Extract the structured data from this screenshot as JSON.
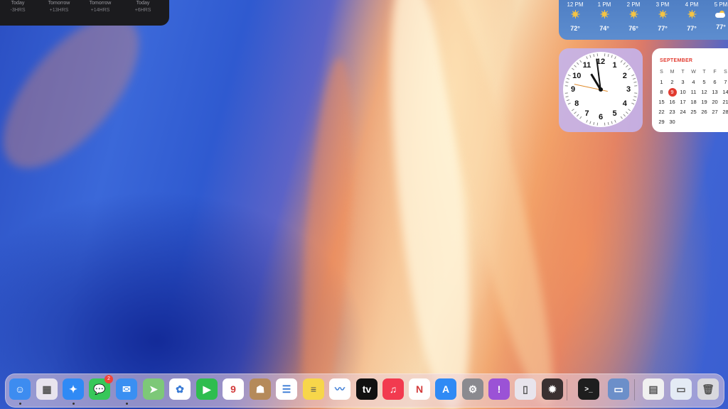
{
  "world_clock": {
    "cities": [
      {
        "day": "Today",
        "offset": "-3HRS"
      },
      {
        "day": "Tomorrow",
        "offset": "+13HRS"
      },
      {
        "day": "Tomorrow",
        "offset": "+14HRS"
      },
      {
        "day": "Today",
        "offset": "+6HRS"
      }
    ]
  },
  "weather": {
    "hours": [
      {
        "time": "12 PM",
        "icon": "sun-icon",
        "temp": "72°"
      },
      {
        "time": "1 PM",
        "icon": "sun-icon",
        "temp": "74°"
      },
      {
        "time": "2 PM",
        "icon": "sun-icon",
        "temp": "76°"
      },
      {
        "time": "3 PM",
        "icon": "sun-icon",
        "temp": "77°"
      },
      {
        "time": "4 PM",
        "icon": "sun-icon",
        "temp": "77°"
      },
      {
        "time": "5 PM",
        "icon": "partly-cloudy-icon",
        "temp": "77°"
      }
    ]
  },
  "clock": {
    "numerals": [
      "12",
      "1",
      "2",
      "3",
      "4",
      "5",
      "6",
      "7",
      "8",
      "9",
      "10",
      "11"
    ],
    "time": {
      "hour": 10,
      "minute": 58,
      "second": 47
    }
  },
  "calendar": {
    "month": "SEPTEMBER",
    "weekdays": [
      "S",
      "M",
      "T",
      "W",
      "T",
      "F",
      "S"
    ],
    "weeks": [
      [
        "1",
        "2",
        "3",
        "4",
        "5",
        "6",
        "7"
      ],
      [
        "8",
        "9",
        "10",
        "11",
        "12",
        "13",
        "14"
      ],
      [
        "15",
        "16",
        "17",
        "18",
        "19",
        "20",
        "21"
      ],
      [
        "22",
        "23",
        "24",
        "25",
        "26",
        "27",
        "28"
      ],
      [
        "29",
        "30",
        "",
        "",
        "",
        "",
        ""
      ]
    ],
    "today": "9"
  },
  "dock": {
    "apps": [
      {
        "name": "finder-icon",
        "color": "#3d8cf0",
        "glyph": "☺",
        "running": true
      },
      {
        "name": "launchpad-icon",
        "color": "#e8e4ee",
        "glyph": "▦",
        "running": false
      },
      {
        "name": "safari-icon",
        "color": "#2f8af5",
        "glyph": "✦",
        "running": true
      },
      {
        "name": "messages-icon",
        "color": "#37c759",
        "glyph": "💬",
        "running": false,
        "badge": "2"
      },
      {
        "name": "mail-icon",
        "color": "#3a8ff2",
        "glyph": "✉",
        "running": true
      },
      {
        "name": "maps-icon",
        "color": "#7dc878",
        "glyph": "➤",
        "running": false
      },
      {
        "name": "photos-icon",
        "color": "#ffffff",
        "glyph": "✿",
        "running": false
      },
      {
        "name": "facetime-icon",
        "color": "#2ebd4f",
        "glyph": "▶",
        "running": false
      },
      {
        "name": "calendar-icon",
        "color": "#ffffff",
        "glyph": "9",
        "running": false
      },
      {
        "name": "contacts-icon",
        "color": "#b58a5a",
        "glyph": "☗",
        "running": false
      },
      {
        "name": "reminders-icon",
        "color": "#ffffff",
        "glyph": "☰",
        "running": false
      },
      {
        "name": "notes-icon",
        "color": "#f7d64a",
        "glyph": "≡",
        "running": false
      },
      {
        "name": "freeform-icon",
        "color": "#ffffff",
        "glyph": "〰",
        "running": false
      },
      {
        "name": "appletv-icon",
        "color": "#111111",
        "glyph": "tv",
        "running": false
      },
      {
        "name": "music-icon",
        "color": "#f23a4f",
        "glyph": "♫",
        "running": false
      },
      {
        "name": "news-icon",
        "color": "#ffffff",
        "glyph": "N",
        "running": false
      },
      {
        "name": "appstore-icon",
        "color": "#2f8af5",
        "glyph": "A",
        "running": false
      },
      {
        "name": "system-settings-icon",
        "color": "#8a8a8f",
        "glyph": "⚙",
        "running": false
      },
      {
        "name": "feedback-icon",
        "color": "#9b52d6",
        "glyph": "!",
        "running": false
      },
      {
        "name": "iphone-mirroring-icon",
        "color": "#e8e4ec",
        "glyph": "▯",
        "running": false
      },
      {
        "name": "bug-app-icon",
        "color": "#3a3030",
        "glyph": "✹",
        "running": false
      },
      {
        "name": "terminal-icon",
        "color": "#1e1e1e",
        "glyph": ">_",
        "running": false
      },
      {
        "name": "preview-icon",
        "color": "#6c8fc9",
        "glyph": "▭",
        "running": false
      },
      {
        "name": "document-icon",
        "color": "#f0f0f0",
        "glyph": "▤",
        "running": false
      },
      {
        "name": "window-stack-icon",
        "color": "#e4ebf5",
        "glyph": "▭",
        "running": false
      },
      {
        "name": "trash-icon",
        "color": "#d9d9de",
        "glyph": "🗑",
        "running": false
      }
    ]
  }
}
